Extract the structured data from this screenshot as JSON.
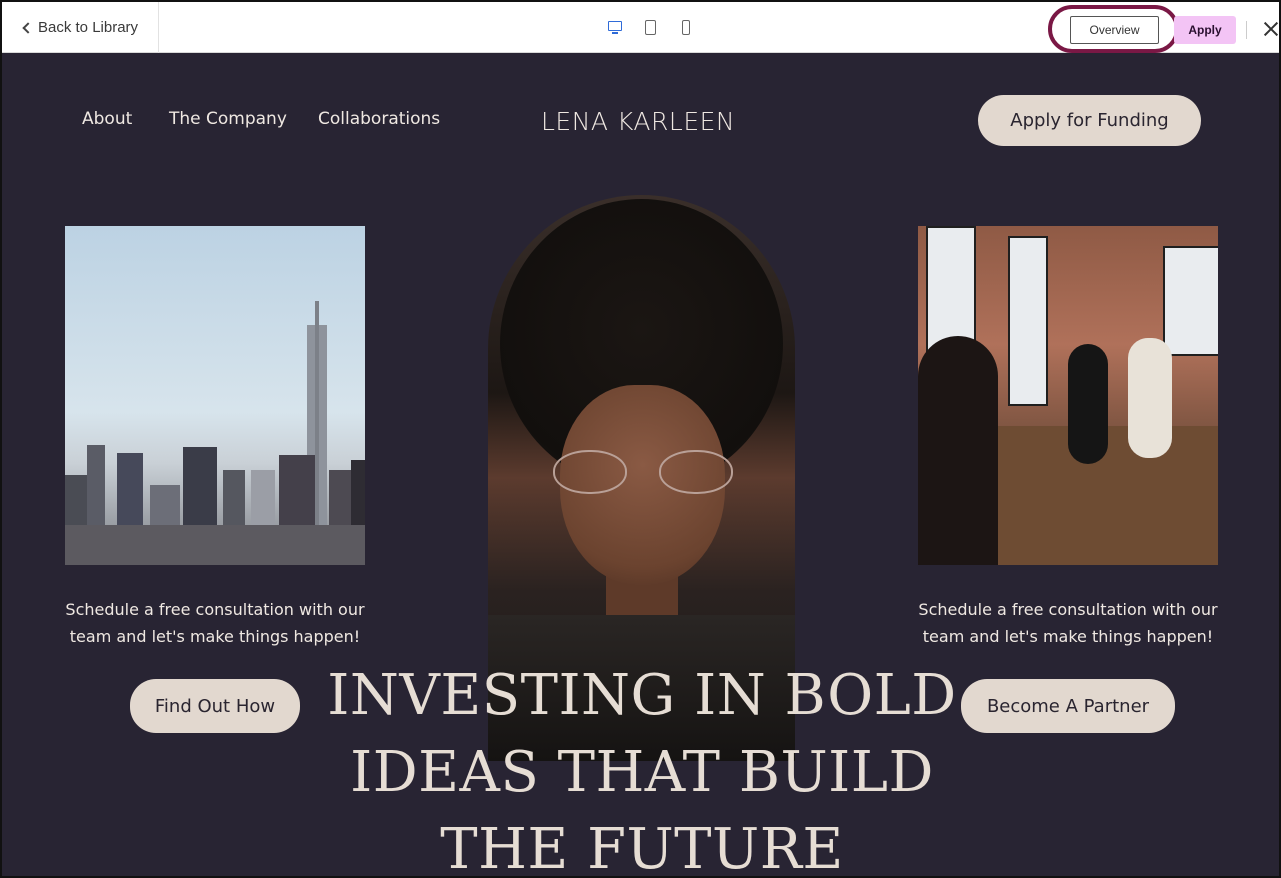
{
  "editor": {
    "back_label": "Back to Library",
    "devices": [
      "desktop-icon",
      "tablet-icon",
      "mobile-icon"
    ],
    "active_device": "desktop",
    "overview_label": "Overview",
    "apply_label": "Apply",
    "accent_color": "#2f6bd8",
    "highlight_color": "#7a1845",
    "apply_bg": "#f3c4f5"
  },
  "site": {
    "nav": [
      "About",
      "The Company",
      "Collaborations"
    ],
    "logo": "LENA KARLEEN",
    "cta": "Apply for Funding",
    "caption_left": "Schedule a free consultation with our team and let's make things happen!",
    "caption_right": "Schedule a free consultation with our team and let's make things happen!",
    "button_left": "Find Out How",
    "button_right": "Become A Partner",
    "headline_lines": [
      "INVESTING IN BOLD",
      "IDEAS THAT BUILD",
      "THE FUTURE"
    ],
    "background": "#282433",
    "button_bg": "#e2d8cf"
  }
}
